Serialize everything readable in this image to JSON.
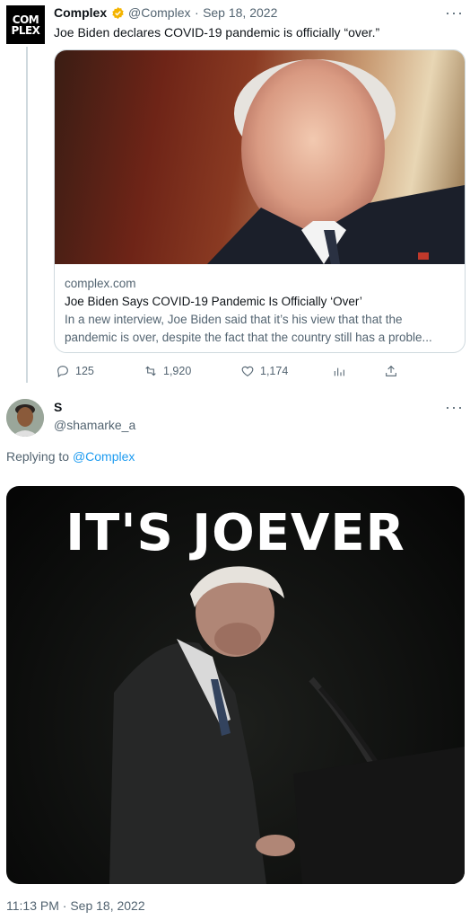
{
  "quoted": {
    "avatar_text_1": "COM",
    "avatar_text_2": "PLEX",
    "name": "Complex",
    "handle": "@Complex",
    "separator": "·",
    "date": "Sep 18, 2022",
    "text": "Joe Biden declares COVID-19 pandemic is officially “over.”",
    "card": {
      "domain": "complex.com",
      "title": "Joe Biden Says COVID-19 Pandemic Is Officially ‘Over’",
      "description": "In a new interview, Joe Biden said that it’s his view that that the pandemic is over, despite the fact that the country still has a proble..."
    },
    "actions": {
      "replies": "125",
      "retweets": "1,920",
      "likes": "1,174"
    },
    "more": "···"
  },
  "reply": {
    "name": "S",
    "handle": "@shamarke_a",
    "replying_prefix": "Replying to",
    "replying_to": "@Complex",
    "image_caption": "IT'S JOEVER",
    "timestamp": "11:13 PM · Sep 18, 2022",
    "more": "···"
  },
  "colors": {
    "link": "#1d9bf0",
    "verified": "#f4b400",
    "muted": "#536471"
  }
}
